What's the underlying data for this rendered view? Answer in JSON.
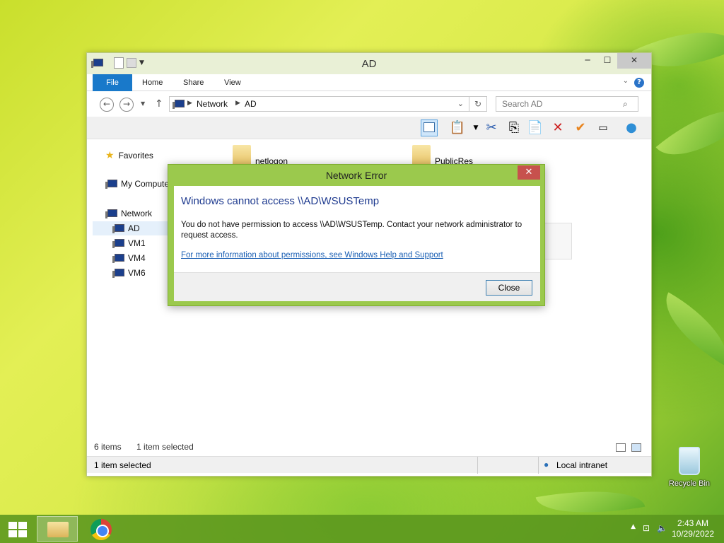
{
  "window": {
    "title": "AD",
    "tabs": [
      "File",
      "Home",
      "Share",
      "View"
    ],
    "breadcrumb": [
      "Network",
      "AD"
    ],
    "search_placeholder": "Search AD",
    "nav": {
      "favorites": "Favorites",
      "my_computer": "My Computer",
      "network": "Network",
      "hosts": [
        "AD",
        "VM1",
        "VM4",
        "VM6"
      ]
    },
    "folders": [
      "netlogon",
      "PublicRes"
    ],
    "status": {
      "items": "6 items",
      "selected": "1 item selected",
      "bottom_selected": "1 item selected",
      "zone": "Local intranet"
    }
  },
  "dialog": {
    "title": "Network Error",
    "heading": "Windows cannot access \\\\AD\\WSUSTemp",
    "message": "You do not have permission to access \\\\AD\\WSUSTemp. Contact your network administrator to request access.",
    "link": "For more information about permissions, see Windows Help and Support",
    "close_button": "Close"
  },
  "desktop": {
    "recycle_bin": "Recycle Bin"
  },
  "taskbar": {
    "time": "2:43 AM",
    "date": "10/29/2022"
  },
  "colors": {
    "accent": "#1979ca",
    "dialog_frame": "#9bc94d",
    "dialog_heading": "#1e3a8f"
  }
}
